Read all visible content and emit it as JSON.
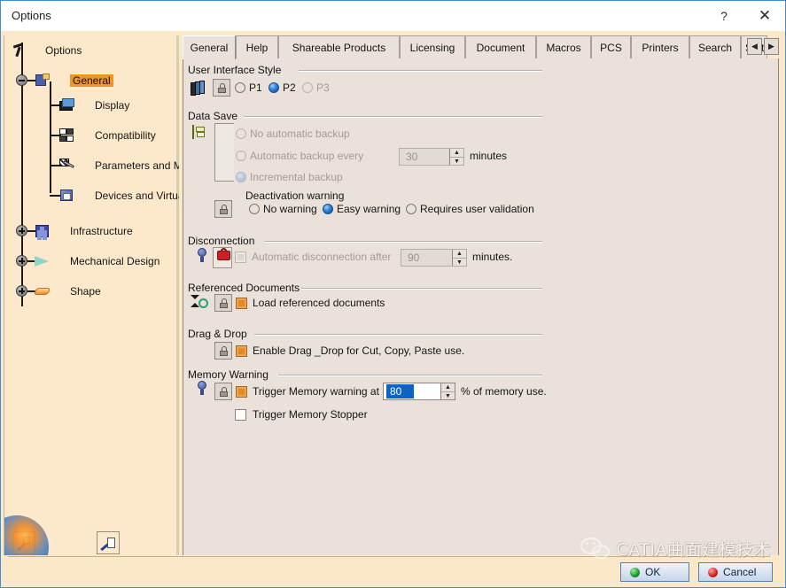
{
  "window": {
    "title": "Options",
    "help_button": "?",
    "close_button": "✕"
  },
  "sidebar": {
    "root": {
      "label": "Options",
      "icon": "options-wrench-icon"
    },
    "items": [
      {
        "label": "General",
        "icon": "general-icon",
        "selected": true,
        "level": 1,
        "expanded": true
      },
      {
        "label": "Display",
        "icon": "display-icon",
        "selected": false,
        "level": 2
      },
      {
        "label": "Compatibility",
        "icon": "compatibility-icon",
        "selected": false,
        "level": 2
      },
      {
        "label": "Parameters and Measure",
        "icon": "parameters-icon",
        "selected": false,
        "level": 2
      },
      {
        "label": "Devices and Virtual Reali",
        "icon": "devices-icon",
        "selected": false,
        "level": 2
      },
      {
        "label": "Infrastructure",
        "icon": "infrastructure-icon",
        "selected": false,
        "level": 1,
        "expanded": false
      },
      {
        "label": "Mechanical Design",
        "icon": "mechanical-design-icon",
        "selected": false,
        "level": 1,
        "expanded": false
      },
      {
        "label": "Shape",
        "icon": "shape-icon",
        "selected": false,
        "level": 1,
        "expanded": false
      }
    ],
    "bottom_buttons": [
      {
        "icon": "settings-home-icon"
      },
      {
        "icon": "settings-document-icon"
      }
    ]
  },
  "tabs": {
    "items": [
      {
        "label": "General",
        "active": true
      },
      {
        "label": "Help",
        "active": false
      },
      {
        "label": "Shareable Products",
        "active": false
      },
      {
        "label": "Licensing",
        "active": false
      },
      {
        "label": "Document",
        "active": false
      },
      {
        "label": "Macros",
        "active": false
      },
      {
        "label": "PCS",
        "active": false
      },
      {
        "label": "Printers",
        "active": false
      },
      {
        "label": "Search",
        "active": false
      },
      {
        "label": "Stat",
        "active": false
      }
    ],
    "scroll_left": "◀",
    "scroll_right": "▶"
  },
  "groups": {
    "user_interface_style": {
      "title": "User Interface Style",
      "options": [
        {
          "label": "P1",
          "selected": false,
          "disabled": false
        },
        {
          "label": "P2",
          "selected": true,
          "disabled": false
        },
        {
          "label": "P3",
          "selected": false,
          "disabled": true
        }
      ]
    },
    "data_save": {
      "title": "Data Save",
      "options": [
        {
          "label": "No automatic backup",
          "selected": false,
          "disabled": true
        },
        {
          "label": "Automatic backup every",
          "selected": false,
          "disabled": true
        },
        {
          "label": "Incremental backup",
          "selected": true,
          "disabled": true
        }
      ],
      "interval_value": "30",
      "interval_unit": "minutes",
      "deactivation_title": "Deactivation warning",
      "deactivation_options": [
        {
          "label": "No warning",
          "selected": false
        },
        {
          "label": "Easy warning",
          "selected": true
        },
        {
          "label": "Requires user validation",
          "selected": false
        }
      ]
    },
    "disconnection": {
      "title": "Disconnection",
      "checkbox_label": "Automatic disconnection after",
      "checkbox_checked": true,
      "disabled": true,
      "value": "90",
      "unit": "minutes."
    },
    "referenced_documents": {
      "title": "Referenced Documents",
      "checkbox_label": "Load referenced documents",
      "checkbox_checked": true
    },
    "drag_drop": {
      "title": "Drag & Drop",
      "checkbox_label": "Enable Drag _Drop for Cut, Copy, Paste use.",
      "checkbox_checked": true
    },
    "memory_warning": {
      "title": "Memory Warning",
      "checkbox_label": "Trigger Memory warning at",
      "checkbox_checked": true,
      "value": "80",
      "unit": "% of memory use.",
      "stopper_label": "Trigger Memory Stopper",
      "stopper_checked": false
    }
  },
  "footer": {
    "ok_label": "OK",
    "cancel_label": "Cancel"
  },
  "watermark": {
    "text": "CATIA曲面建模技术"
  },
  "colors": {
    "sidebar_bg": "#fce9cb",
    "panel_bg": "#e9e1da",
    "selection": "#f0932b",
    "radio_on": "#2f7fd6",
    "checkbox_checked": "#f2a24a",
    "highlight": "#0a64c8",
    "window_border": "#3f8fd2"
  }
}
